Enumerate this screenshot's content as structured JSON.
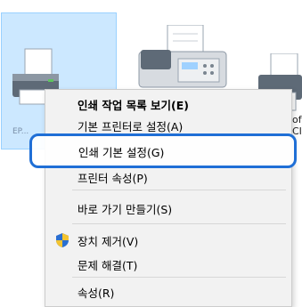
{
  "desktop": {
    "printers": [
      {
        "name": "printer-epson",
        "label": "EP..."
      },
      {
        "name": "printer-fax",
        "label": ""
      },
      {
        "name": "printer-other",
        "label": "of"
      }
    ],
    "right_edge_text_1": "of",
    "right_edge_text_2": "CI"
  },
  "context_menu": {
    "items": [
      {
        "label": "인쇄 작업 목록 보기(E)",
        "bold": true
      },
      {
        "label": "기본 프린터로 설정(A)",
        "bold": false
      },
      {
        "label": "인쇄 기본 설정(G)",
        "bold": false,
        "highlighted": true
      },
      {
        "label": "프린터 속성(P)",
        "bold": false
      },
      {
        "label": "바로 가기 만들기(S)",
        "bold": false
      },
      {
        "label": "장치 제거(V)",
        "bold": false,
        "icon": "shield-icon"
      },
      {
        "label": "문제 해결(T)",
        "bold": false
      },
      {
        "label": "속성(R)",
        "bold": false
      }
    ]
  },
  "colors": {
    "selection": "#cce8ff",
    "highlight_ring": "#1f6fd6",
    "menu_bg": "#f2f2f2"
  }
}
